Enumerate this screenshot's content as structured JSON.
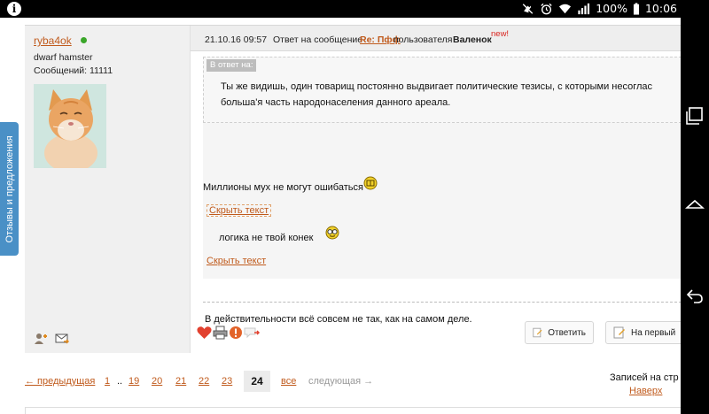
{
  "status_bar": {
    "info_icon_text": "i",
    "icons": [
      "mute-icon",
      "alarm-icon",
      "wifi-icon",
      "signal-icon"
    ],
    "battery_percent": "100%",
    "time": "10:06"
  },
  "feedback_tab": {
    "label": "Отзывы и предложения"
  },
  "author": {
    "name": "ryba4ok",
    "status": "dwarf hamster",
    "posts": "Сообщений: 11111",
    "online_color": "#3aa629"
  },
  "post": {
    "date": "21.10.16 09:57",
    "reply_text": "Ответ на сообщение",
    "reply_link": "Re: Пфф",
    "of_user_text": "пользователя",
    "user": "Валенок",
    "new_badge": "new!",
    "quote_label": "В ответ на:",
    "quote_line1": "Ты же видишь, один товарищ постоянно выдвигает политические тезисы, с которыми несоглас",
    "quote_line2": "больша'я часть народонаселения данного ареала.",
    "text_millions": "Миллионы мух не могут ошибаться",
    "hide_link_1": "Скрыть текст",
    "text_logic": "логика не твой конек",
    "hide_link_2": "Скрыть текст",
    "signature": "В действительности всё совсем не так, как на самом деле."
  },
  "buttons": {
    "reply": "Ответить",
    "to_first": "На первый"
  },
  "pagination": {
    "prev": "← предыдущая",
    "pages": [
      "1",
      "..",
      "19",
      "20",
      "21",
      "22",
      "23"
    ],
    "current": "24",
    "all": "все",
    "next": "следующая →"
  },
  "footer": {
    "records": "Записей на стр",
    "to_top": "Наверх"
  },
  "colors": {
    "link": "#c05a1c",
    "feedback_tab": "#4a90c6",
    "new_badge": "#d9231d"
  }
}
